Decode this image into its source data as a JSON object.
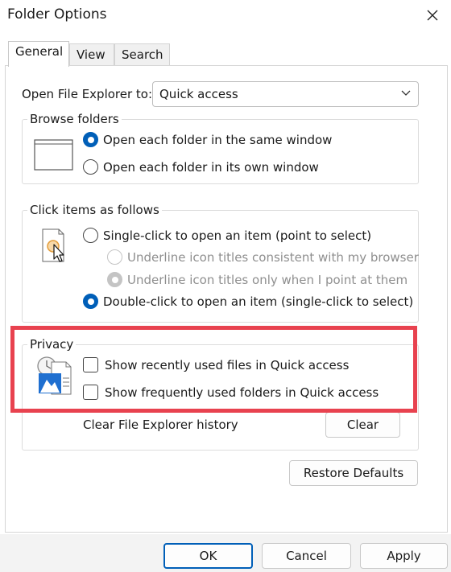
{
  "window": {
    "title": "Folder Options"
  },
  "tabs": [
    {
      "label": "General",
      "active": true
    },
    {
      "label": "View",
      "active": false
    },
    {
      "label": "Search",
      "active": false
    }
  ],
  "general": {
    "open_explorer_label": "Open File Explorer to:",
    "open_explorer_value": "Quick access",
    "browse": {
      "title": "Browse folders",
      "options": [
        {
          "label": "Open each folder in the same window",
          "checked": true
        },
        {
          "label": "Open each folder in its own window",
          "checked": false
        }
      ]
    },
    "click": {
      "title": "Click items as follows",
      "single": {
        "label": "Single-click to open an item (point to select)",
        "checked": false
      },
      "underline_browser": {
        "label": "Underline icon titles consistent with my browser",
        "checked": false,
        "disabled": true
      },
      "underline_point": {
        "label": "Underline icon titles only when I point at them",
        "checked": true,
        "disabled": true
      },
      "double": {
        "label": "Double-click to open an item (single-click to select)",
        "checked": true
      }
    },
    "privacy": {
      "title": "Privacy",
      "recent_files": {
        "label": "Show recently used files in Quick access",
        "checked": false
      },
      "frequent_folders": {
        "label": "Show frequently used folders in Quick access",
        "checked": false
      },
      "clear_history_label": "Clear File Explorer history",
      "clear_button": "Clear"
    },
    "restore_defaults_button": "Restore Defaults"
  },
  "buttons": {
    "ok": "OK",
    "cancel": "Cancel",
    "apply": "Apply"
  },
  "colors": {
    "accent": "#005fb8",
    "highlight": "#e8424f"
  }
}
